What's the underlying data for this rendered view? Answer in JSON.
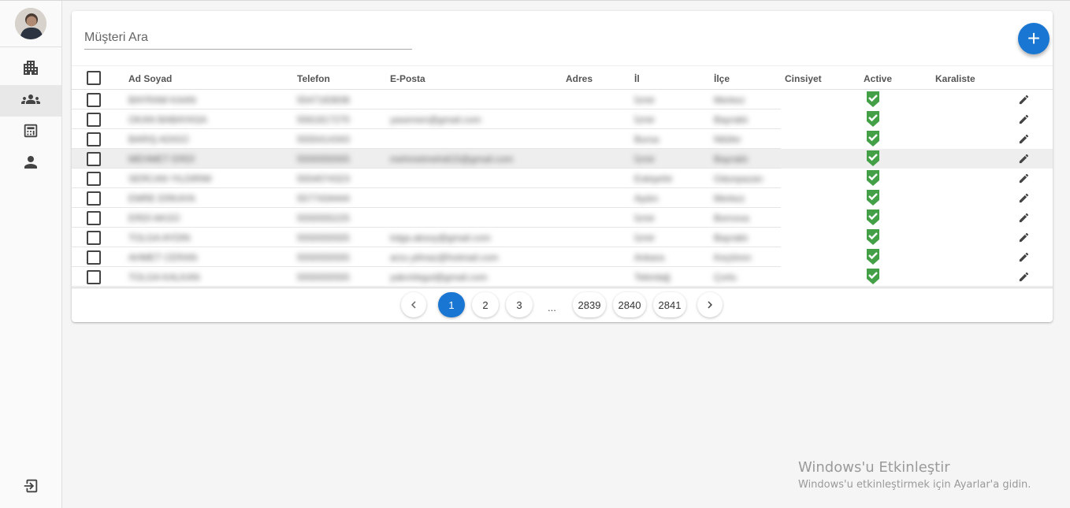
{
  "search": {
    "placeholder": "Müşteri Ara"
  },
  "add_button": {
    "label": "+"
  },
  "sidebar": {
    "items": [
      {
        "icon": "building-icon",
        "active": false
      },
      {
        "icon": "customers-icon",
        "active": true
      },
      {
        "icon": "calculator-icon",
        "active": false
      },
      {
        "icon": "person-icon",
        "active": false
      }
    ],
    "logout_icon": "logout-icon"
  },
  "columns": [
    "Ad Soyad",
    "Telefon",
    "E-Posta",
    "Adres",
    "İl",
    "İlçe",
    "Cinsiyet",
    "Active",
    "Karaliste"
  ],
  "rows": [
    {
      "name": "BAYRAM KAAN",
      "phone": "5547183838",
      "email": "",
      "city": "İzmir",
      "district": "Merkez",
      "active": true
    },
    {
      "name": "OKAN BABAYASA",
      "phone": "5561817270",
      "email": "yasemen@gmail.com",
      "city": "İzmir",
      "district": "Bayraklı",
      "active": true
    },
    {
      "name": "BARIŞ ADIGÜ",
      "phone": "5555414343",
      "email": "",
      "city": "Bursa",
      "district": "Nilüfer",
      "active": true
    },
    {
      "name": "MEHMET ERDİ",
      "phone": "5555555555",
      "email": "mehmetmehdi15@gmail.com",
      "city": "İzmir",
      "district": "Bayraklı",
      "active": true
    },
    {
      "name": "SERCAN YILDIRIM",
      "phone": "5554074323",
      "email": "",
      "city": "Eskişehir",
      "district": "Odunpazarı",
      "active": true
    },
    {
      "name": "EMRE ERKAYA",
      "phone": "5577434444",
      "email": "",
      "city": "Aydın",
      "district": "Merkez",
      "active": true
    },
    {
      "name": "ERDİ AKGÜ",
      "phone": "5555555225",
      "email": "",
      "city": "İzmir",
      "district": "Bornova",
      "active": true
    },
    {
      "name": "TOLGA AYDIN",
      "phone": "5555555555",
      "email": "tolga.aksoy@gmail.com",
      "city": "İzmir",
      "district": "Bayraklı",
      "active": true
    },
    {
      "name": "AHMET CERAN",
      "phone": "5555555555",
      "email": "arzu.yilmaz@hotmail.com",
      "city": "Ankara",
      "district": "Keçiören",
      "active": true
    },
    {
      "name": "TOLGA KALKAN",
      "phone": "5555555555",
      "email": "yakınlıkgul@gmail.com",
      "city": "Tekirdağ",
      "district": "Çorlu",
      "active": true
    }
  ],
  "pagination": {
    "prev": "‹",
    "pages": [
      "1",
      "2",
      "3"
    ],
    "ellipsis": "...",
    "last_pages": [
      "2839",
      "2840",
      "2841"
    ],
    "next": "›",
    "current": "1"
  },
  "watermark": {
    "title": "Windows'u Etkinleştir",
    "subtitle": "Windows'u etkinleştirmek için Ayarlar'a gidin."
  },
  "colors": {
    "primary": "#1976d2",
    "active_green": "#43a047"
  }
}
